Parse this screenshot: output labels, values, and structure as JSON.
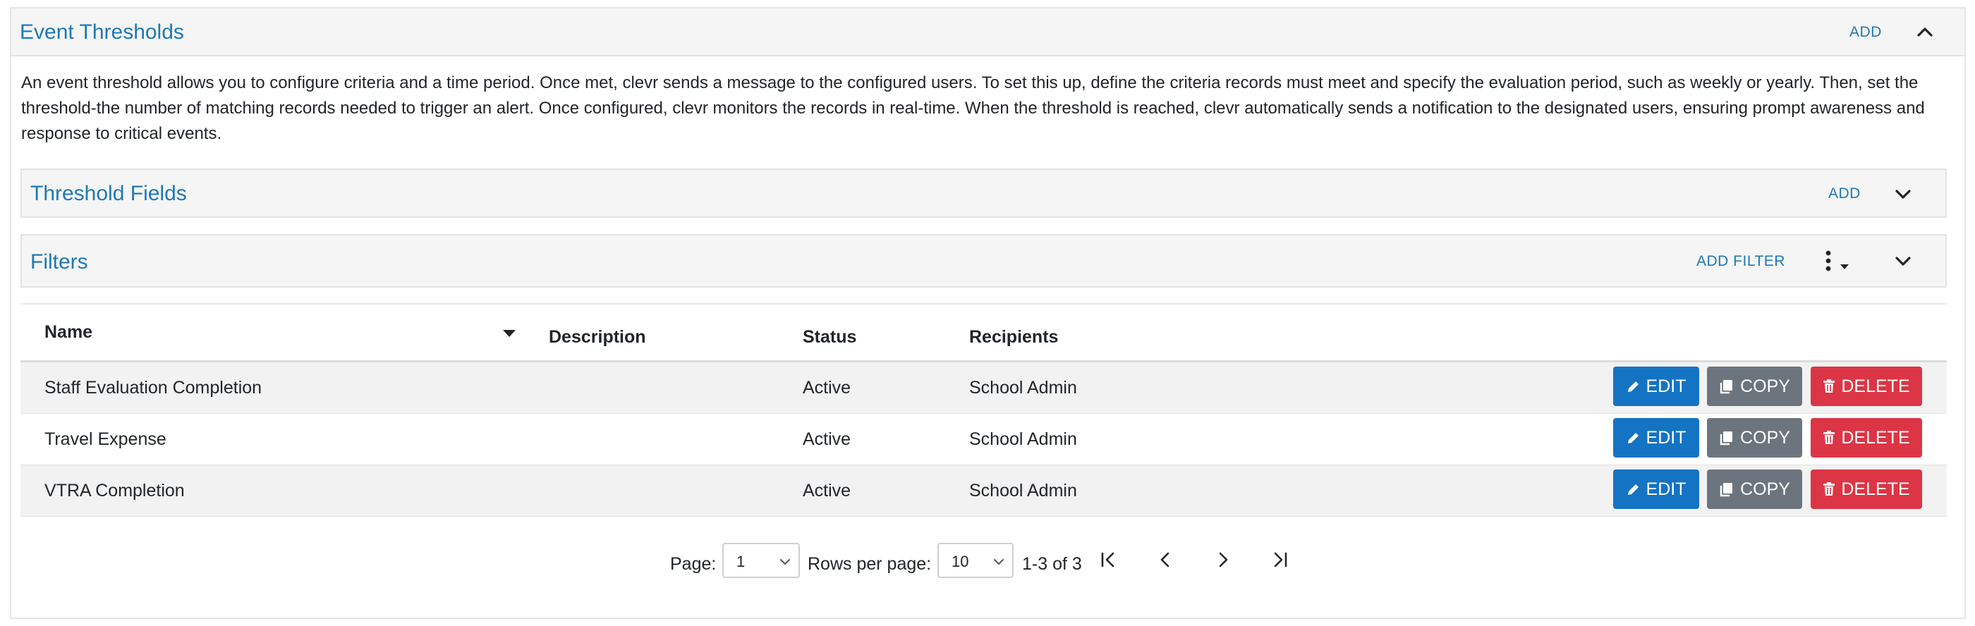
{
  "panel": {
    "title": "Event Thresholds",
    "add_label": "ADD",
    "description": "An event threshold allows you to configure criteria and a time period. Once met, clevr sends a message to the configured users. To set this up, define the criteria records must meet and specify the evaluation period, such as weekly or yearly. Then, set the threshold-the number of matching records needed to trigger an alert. Once configured, clevr monitors the records in real-time. When the threshold is reached, clevr automatically sends a notification to the designated users, ensuring prompt awareness and response to critical events."
  },
  "threshold_fields": {
    "title": "Threshold Fields",
    "add_label": "ADD"
  },
  "filters": {
    "title": "Filters",
    "add_label": "ADD FILTER"
  },
  "table": {
    "headers": {
      "name": "Name",
      "description": "Description",
      "status": "Status",
      "recipients": "Recipients"
    },
    "rows": [
      {
        "name": "Staff Evaluation Completion",
        "description": "",
        "status": "Active",
        "recipients": "School Admin"
      },
      {
        "name": "Travel Expense",
        "description": "",
        "status": "Active",
        "recipients": "School Admin"
      },
      {
        "name": "VTRA Completion",
        "description": "",
        "status": "Active",
        "recipients": "School Admin"
      }
    ],
    "actions": {
      "edit": "EDIT",
      "copy": "COPY",
      "delete": "DELETE"
    }
  },
  "pagination": {
    "page_label": "Page:",
    "page_value": "1",
    "rows_label": "Rows per page:",
    "rows_value": "10",
    "range_text": "1-3 of 3"
  },
  "colors": {
    "link": "#1f78b4",
    "edit": "#1473c3",
    "copy": "#6c757d",
    "delete": "#dc3545"
  }
}
